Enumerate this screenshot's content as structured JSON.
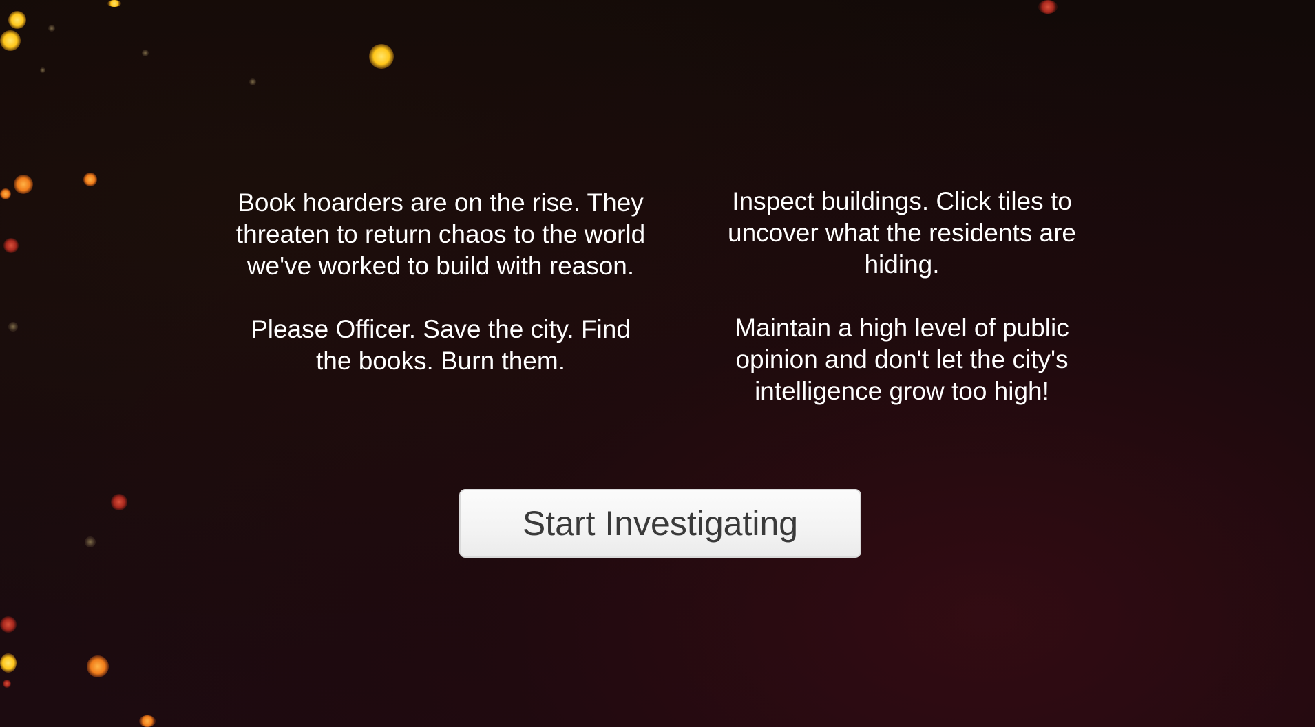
{
  "intro": {
    "left_paragraphs": [
      "Book hoarders are on the rise. They threaten to return chaos to the world we've worked to build with reason.",
      "Please Officer. Save the city. Find the books. Burn them."
    ],
    "right_paragraphs": [
      "Inspect buildings. Click tiles to uncover what the residents are hiding.",
      "Maintain a high level of public opinion and don't let the city's intelligence grow too high!"
    ]
  },
  "start_button": {
    "label": "Start Investigating"
  },
  "colors": {
    "background": "#150a0b",
    "text": "#ffffff",
    "button_bg": "#f5f5f5",
    "button_text": "#3a3a3a",
    "ember_yellow": "#ffc61a",
    "ember_orange": "#f07c1a",
    "ember_red": "#a8281e"
  }
}
